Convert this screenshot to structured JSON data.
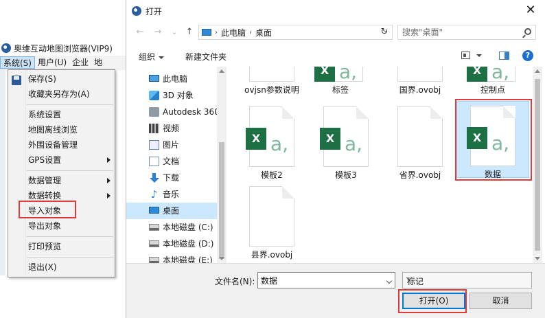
{
  "app": {
    "title": "奥维互动地图浏览器(VIP9)",
    "menubar": [
      "系统(S)",
      "用户(U)",
      "企业",
      "地"
    ],
    "dropdown": [
      {
        "label": "保存(S)",
        "submenu": false
      },
      {
        "label": "收藏夹另存为(A)",
        "submenu": false
      },
      {
        "label": "系统设置",
        "submenu": false
      },
      {
        "label": "地图离线浏览",
        "submenu": false
      },
      {
        "label": "外围设备管理",
        "submenu": false
      },
      {
        "label": "GPS设置",
        "submenu": true
      },
      {
        "label": "数据管理",
        "submenu": true
      },
      {
        "label": "数据转换",
        "submenu": true
      },
      {
        "label": "导入对象",
        "submenu": false
      },
      {
        "label": "导出对象",
        "submenu": false
      },
      {
        "label": "打印预览",
        "submenu": false
      },
      {
        "label": "退出(X)",
        "submenu": false
      }
    ]
  },
  "dialog": {
    "title": "打开",
    "close_glyph": "✕",
    "nav": {
      "back": "←",
      "forward": "→",
      "history": "⌄",
      "up": "↑",
      "refresh": "↻"
    },
    "address": [
      "此电脑",
      "桌面"
    ],
    "search_placeholder": "搜索\"桌面\"",
    "toolbar": {
      "organize": "组织",
      "new_folder": "新建文件夹",
      "help": "?"
    },
    "sidebar": [
      {
        "label": "此电脑",
        "icon": "pc-icon",
        "selected": false
      },
      {
        "label": "3D 对象",
        "icon": "cube-icon",
        "selected": false
      },
      {
        "label": "Autodesk 360",
        "icon": "autodesk-icon",
        "selected": false
      },
      {
        "label": "视频",
        "icon": "video-icon",
        "selected": false
      },
      {
        "label": "图片",
        "icon": "picture-icon",
        "selected": false
      },
      {
        "label": "文档",
        "icon": "document-icon",
        "selected": false
      },
      {
        "label": "下载",
        "icon": "download-icon",
        "selected": false
      },
      {
        "label": "音乐",
        "icon": "music-icon",
        "selected": false
      },
      {
        "label": "桌面",
        "icon": "desktop-icon",
        "selected": true
      },
      {
        "label": "本地磁盘 (C:)",
        "icon": "disk-icon",
        "selected": false
      },
      {
        "label": "本地磁盘 (D:)",
        "icon": "disk-icon",
        "selected": false
      },
      {
        "label": "本地磁盘 (E:)",
        "icon": "disk-icon",
        "selected": false
      }
    ],
    "files": [
      {
        "name": "ovjsn参数说明",
        "type": "blank"
      },
      {
        "name": "标签",
        "type": "excel"
      },
      {
        "name": "国界.ovobj",
        "type": "blank"
      },
      {
        "name": "控制点",
        "type": "excel"
      },
      {
        "name": "模板2",
        "type": "excel"
      },
      {
        "name": "模板3",
        "type": "excel"
      },
      {
        "name": "省界.ovobj",
        "type": "blank"
      },
      {
        "name": "数据",
        "type": "excel",
        "selected": true
      },
      {
        "name": "县界.ovobj",
        "type": "blank"
      }
    ],
    "filename_label": "文件名(N):",
    "filename_value": "数据",
    "filetype_value": "标记",
    "open_button": "打开(O)",
    "cancel_button": "取消"
  },
  "colors": {
    "highlight": "#e03a3a",
    "selection": "#cce8ff",
    "excel": "#1d7044"
  }
}
